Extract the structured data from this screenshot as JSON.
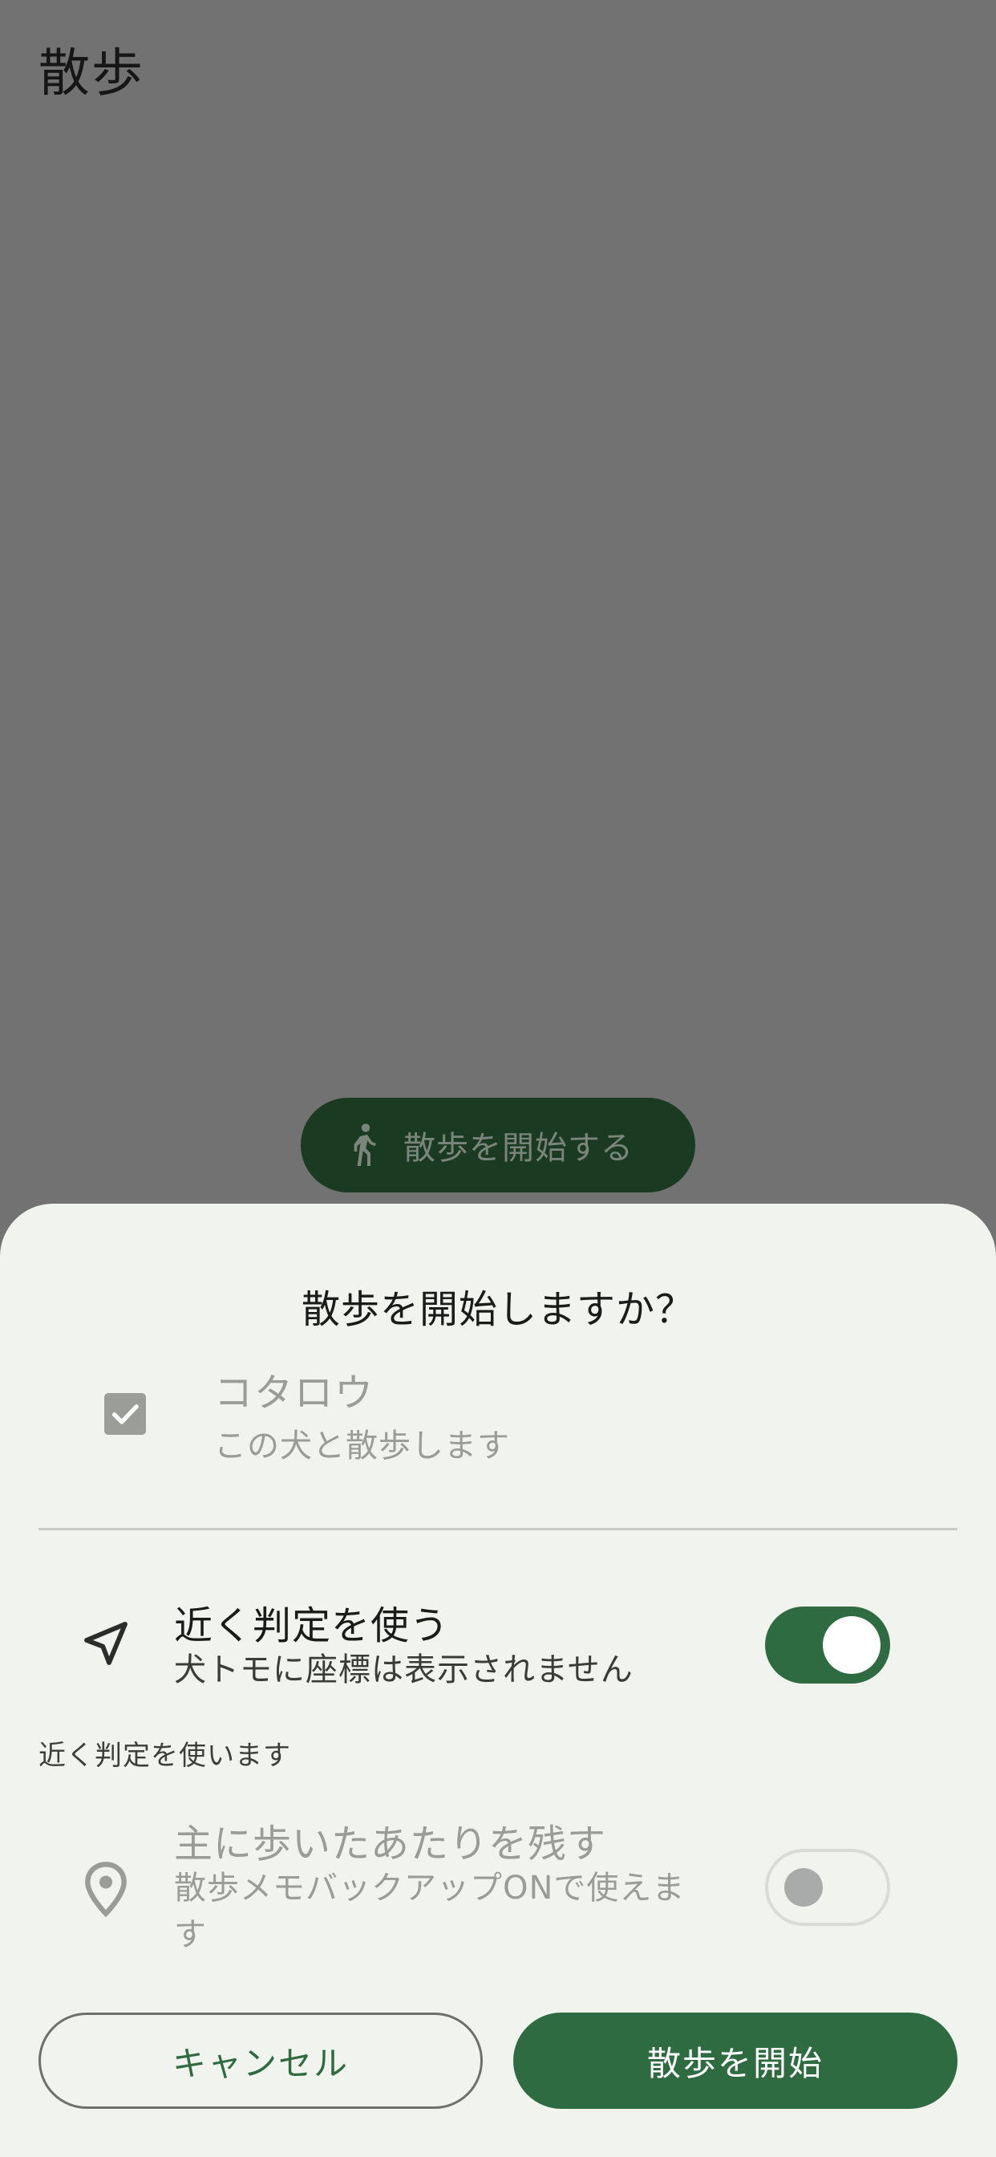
{
  "page": {
    "title": "散歩",
    "start_fab_label": "散歩を開始する"
  },
  "sheet": {
    "title": "散歩を開始しますか？",
    "dog": {
      "name": "コタロウ",
      "subtitle": "この犬と散歩します",
      "checked": true
    },
    "nearby": {
      "title": "近く判定を使う",
      "subtitle": "犬トモに座標は表示されません",
      "enabled": true,
      "helper": "近く判定を使います"
    },
    "route": {
      "title": "主に歩いたあたりを残す",
      "subtitle_line1": "散歩メモバックアップONで使えま",
      "subtitle_line2": "す",
      "enabled": false
    },
    "cancel_label": "キャンセル",
    "confirm_label": "散歩を開始"
  },
  "colors": {
    "scrim": "#727272",
    "sheet_bg": "#f1f4ee",
    "primary": "#2f6b40",
    "fab_dimmed": "#1a3a22",
    "disabled_text": "#9a9c98"
  },
  "icons": {
    "fab": "walking-person-icon",
    "dog_checkbox": "check-icon",
    "nearby": "navigation-arrow-icon",
    "route": "map-pin-icon"
  }
}
